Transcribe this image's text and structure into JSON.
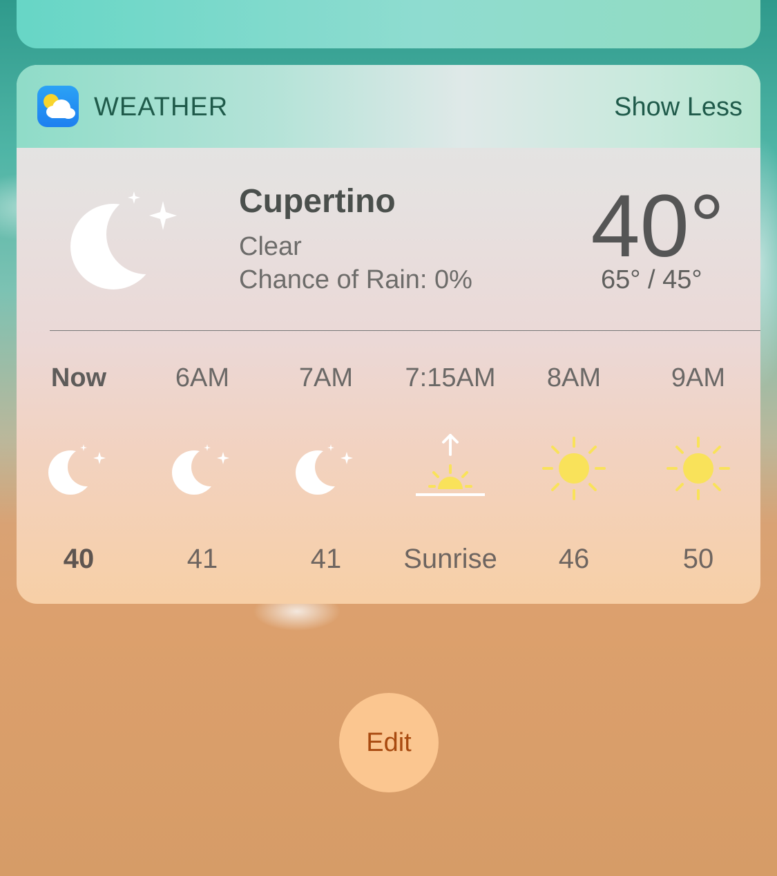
{
  "widget": {
    "app_name": "WEATHER",
    "show_less_label": "Show Less"
  },
  "current": {
    "city": "Cupertino",
    "condition": "Clear",
    "chance_of_rain": "Chance of Rain: 0%",
    "temperature": "40°",
    "high_low": "65° / 45°",
    "icon": "moon-stars-icon"
  },
  "hourly": [
    {
      "time": "Now",
      "icon": "moon-stars-icon",
      "temp": "40"
    },
    {
      "time": "6AM",
      "icon": "moon-stars-icon",
      "temp": "41"
    },
    {
      "time": "7AM",
      "icon": "moon-stars-icon",
      "temp": "41"
    },
    {
      "time": "7:15AM",
      "icon": "sunrise-icon",
      "temp": "Sunrise"
    },
    {
      "time": "8AM",
      "icon": "sun-icon",
      "temp": "46"
    },
    {
      "time": "9AM",
      "icon": "sun-icon",
      "temp": "50"
    }
  ],
  "edit_label": "Edit",
  "colors": {
    "sun": "#f9e25a",
    "moon": "#ffffff",
    "edit_button": "#fbc690",
    "edit_text": "#a84a10",
    "header_text": "#1f5a4a"
  }
}
